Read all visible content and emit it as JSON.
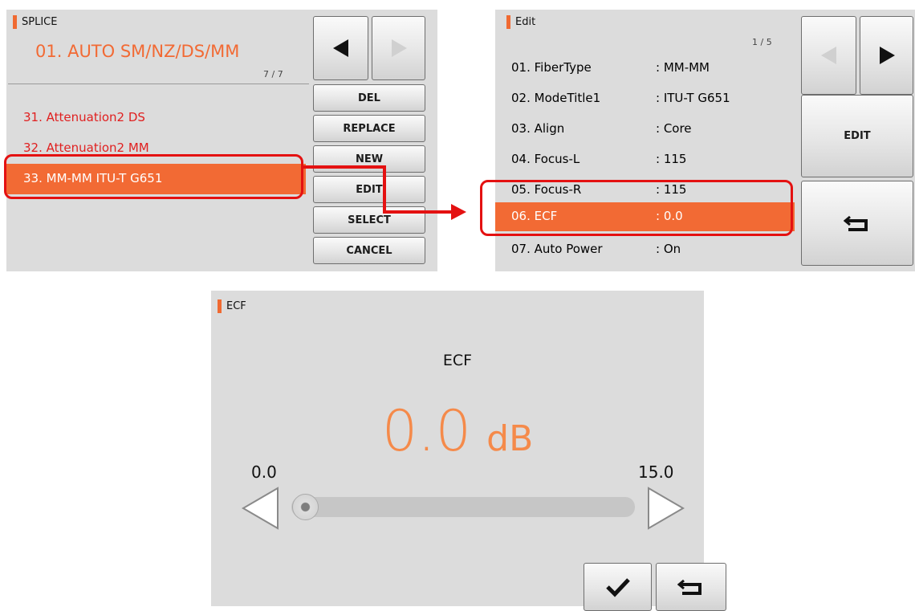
{
  "splice": {
    "title": "SPLICE",
    "mode_title": "01. AUTO SM/NZ/DS/MM",
    "page": "7 / 7",
    "items": [
      {
        "label": "31. Attenuation2 DS"
      },
      {
        "label": "32. Attenuation2 MM"
      },
      {
        "label": "33. MM-MM ITU-T G651"
      }
    ],
    "buttons": {
      "del": "DEL",
      "replace": "REPLACE",
      "new": "NEW",
      "edit": "EDIT",
      "select": "SELECT",
      "cancel": "CANCEL"
    }
  },
  "edit": {
    "title": "Edit",
    "page": "1 / 5",
    "rows": [
      {
        "label": "01. FiberType",
        "value": ": MM-MM"
      },
      {
        "label": "02. ModeTitle1",
        "value": ": ITU-T G651"
      },
      {
        "label": "03. Align",
        "value": ": Core"
      },
      {
        "label": "04. Focus-L",
        "value": ": 115"
      },
      {
        "label": "05. Focus-R",
        "value": ": 115"
      },
      {
        "label": "06. ECF",
        "value": ": 0.0"
      },
      {
        "label": "07. Auto Power",
        "value": ": On"
      }
    ],
    "buttons": {
      "edit": "EDIT"
    }
  },
  "ecf": {
    "title": "ECF",
    "param_name": "ECF",
    "value": "0.0",
    "unit": "dB",
    "min": "0.0",
    "max": "15.0",
    "slider_fraction": 0
  },
  "colors": {
    "accent": "#f06a32",
    "highlight": "#e41111",
    "panel": "#dcdcdc"
  }
}
